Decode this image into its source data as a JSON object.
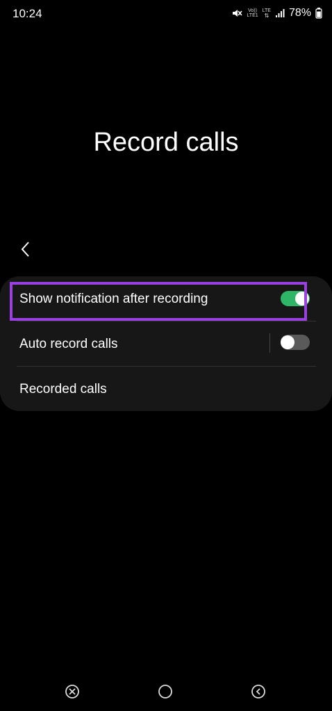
{
  "status_bar": {
    "time": "10:24",
    "network_line1": "Vo))",
    "network_line2": "LTE1",
    "network_type": "LTE",
    "battery_percent": "78%",
    "icons": [
      "mute-icon",
      "volte-icon",
      "signal-icon",
      "battery-icon"
    ]
  },
  "page": {
    "title": "Record calls"
  },
  "settings": {
    "items": [
      {
        "label": "Show notification after recording",
        "toggle": true
      },
      {
        "label": "Auto record calls",
        "toggle": false
      },
      {
        "label": "Recorded calls"
      }
    ]
  },
  "colors": {
    "background": "#000000",
    "card": "#171717",
    "toggle_on": "#2fb567",
    "toggle_off": "#5a5a5a",
    "highlight": "#9a40e0"
  },
  "nav": {
    "icons": [
      "recent-apps-icon",
      "home-icon",
      "back-icon"
    ]
  }
}
